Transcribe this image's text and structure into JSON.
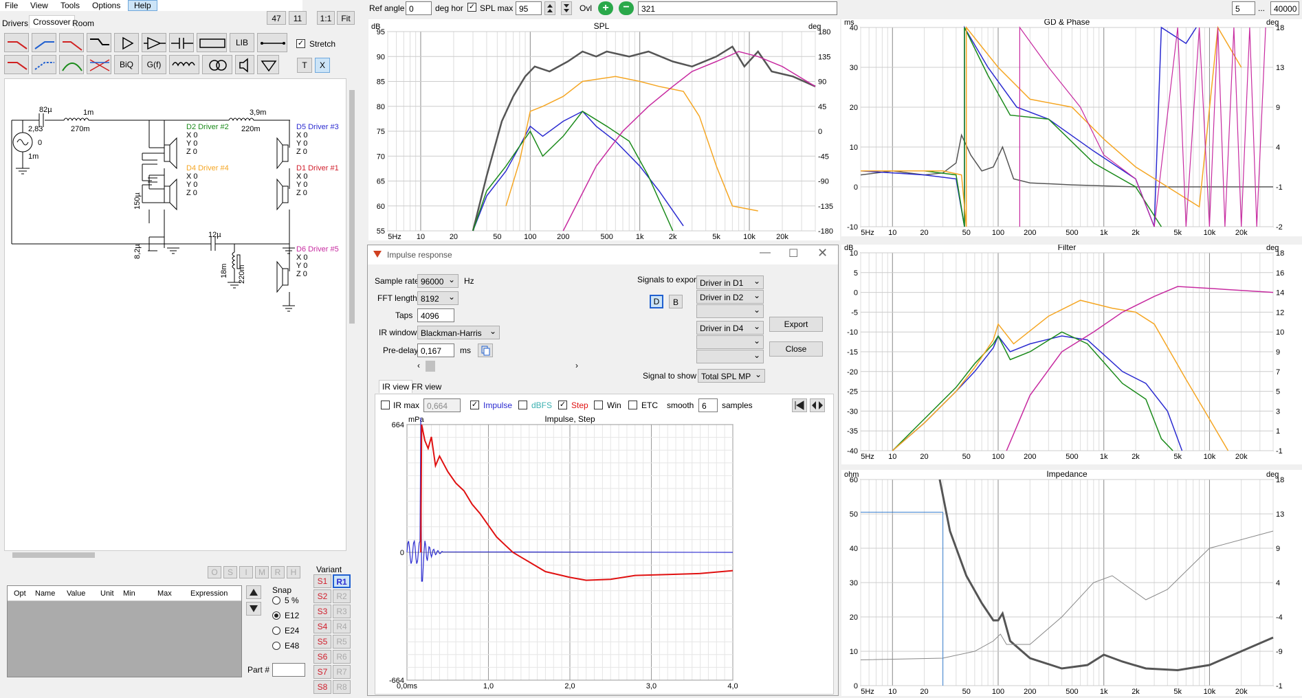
{
  "menu": [
    "File",
    "View",
    "Tools",
    "Options",
    "Help"
  ],
  "tabs": [
    "Drivers",
    "Crossover",
    "Room"
  ],
  "small_buttons": [
    "47",
    "11",
    "1:1",
    "Fit"
  ],
  "tools_row1": [
    "LIB"
  ],
  "tools_row2": [
    "BiQ",
    "G(f)",
    "T",
    "X"
  ],
  "stretch_label": "Stretch",
  "top": {
    "ref_angle_label": "Ref angle",
    "ref_angle": "0",
    "deg_hor": "deg hor",
    "spl_max_label": "SPL max",
    "spl_max": "95",
    "ovl_label": "Ovl",
    "ovl_value": "321",
    "range_lo": "5",
    "range_sep": "...",
    "range_hi": "40000"
  },
  "schematic": {
    "parts": [
      "82µ",
      "1m",
      "270m",
      "2,83",
      "0",
      "1m",
      "150µ",
      "8,2µ",
      "3,9m",
      "220m",
      "12µ",
      "18m",
      "220m"
    ],
    "drivers": [
      {
        "name": "D2 Driver #2",
        "color": "#1a8a1a",
        "xyz": [
          "X 0",
          "Y 0",
          "Z 0"
        ]
      },
      {
        "name": "D4 Driver #4",
        "color": "#f5a623",
        "xyz": [
          "X 0",
          "Y 0",
          "Z 0"
        ]
      },
      {
        "name": "D5 Driver #3",
        "color": "#2a2ad0",
        "xyz": [
          "X 0",
          "Y 0",
          "Z 0"
        ]
      },
      {
        "name": "D1 Driver #1",
        "color": "#d01c2a",
        "xyz": [
          "X 0",
          "Y 0",
          "Z 0"
        ]
      },
      {
        "name": "D6 Driver #5",
        "color": "#c72aa0",
        "xyz": [
          "X 0",
          "Y 0",
          "Z 0"
        ]
      }
    ]
  },
  "opt_buttons": [
    "O",
    "S",
    "I",
    "M",
    "R",
    "H"
  ],
  "table_headers": [
    "Opt",
    "Name",
    "Value",
    "Unit",
    "Min",
    "Max",
    "Expression"
  ],
  "snap": {
    "title": "Snap",
    "options": [
      "5 %",
      "E12",
      "E24",
      "E48"
    ],
    "selected": 1
  },
  "part_label": "Part #",
  "variant": {
    "title": "Variant",
    "s": [
      "S1",
      "S2",
      "S3",
      "S4",
      "S5",
      "S6",
      "S7",
      "S8"
    ],
    "r": [
      "R1",
      "R2",
      "R3",
      "R4",
      "R5",
      "R6",
      "R7",
      "R8"
    ]
  },
  "spl": {
    "title": "SPL",
    "left_unit": "dB",
    "right_unit": "deg",
    "y": [
      "95",
      "90",
      "85",
      "80",
      "75",
      "70",
      "65",
      "60",
      "55"
    ],
    "y2": [
      "180",
      "135",
      "90",
      "45",
      "0",
      "-45",
      "-90",
      "-135",
      "-180"
    ],
    "x": [
      "5Hz",
      "10",
      "20",
      "50",
      "100",
      "200",
      "500",
      "1k",
      "2k",
      "5k",
      "10k",
      "20k"
    ]
  },
  "gd": {
    "title": "GD & Phase",
    "left_unit": "ms",
    "right_unit": "deg",
    "y": [
      "40",
      "30",
      "20",
      "10",
      "0",
      "-10"
    ],
    "y2": [
      "18",
      "13",
      "9",
      "4",
      "-1",
      "-2"
    ],
    "x": [
      "5Hz",
      "10",
      "20",
      "50",
      "100",
      "200",
      "500",
      "1k",
      "2k",
      "5k",
      "10k",
      "20k"
    ]
  },
  "filter": {
    "title": "Filter",
    "left_unit": "dB",
    "right_unit": "deg",
    "y": [
      "10",
      "5",
      "0",
      "-5",
      "-10",
      "-15",
      "-20",
      "-25",
      "-30",
      "-35",
      "-40"
    ],
    "y2": [
      "18",
      "16",
      "14",
      "12",
      "10",
      "9",
      "7",
      "5",
      "3",
      "1",
      "-1"
    ],
    "x": [
      "5Hz",
      "10",
      "20",
      "50",
      "100",
      "200",
      "500",
      "1k",
      "2k",
      "5k",
      "10k",
      "20k"
    ]
  },
  "imp": {
    "title": "Impedance",
    "left_unit": "ohm",
    "right_unit": "deg",
    "y": [
      "60",
      "50",
      "40",
      "30",
      "20",
      "10",
      "0"
    ],
    "y2": [
      "18",
      "13",
      "9",
      "4",
      "-4",
      "-9",
      "-1"
    ],
    "x": [
      "5Hz",
      "10",
      "20",
      "50",
      "100",
      "200",
      "500",
      "1k",
      "2k",
      "5k",
      "10k",
      "20k"
    ]
  },
  "ir": {
    "title": "Impulse response",
    "sample_rate_label": "Sample rate",
    "sample_rate": "96000",
    "hz": "Hz",
    "fft_label": "FFT length",
    "fft": "8192",
    "taps_label": "Taps",
    "taps": "4096",
    "window_label": "IR window",
    "window": "Blackman-Harris",
    "predelay_label": "Pre-delay",
    "predelay": "0,167",
    "ms": "ms",
    "signals_label": "Signals to export",
    "signals": [
      "Driver in D1",
      "Driver in D2",
      "",
      "Driver in D4",
      "",
      ""
    ],
    "db": [
      "D",
      "B"
    ],
    "export": "Export",
    "close": "Close",
    "show_label": "Signal to show",
    "show": "Total SPL MP",
    "subtabs": [
      "IR view",
      "FR view"
    ],
    "ir_max_label": "IR max",
    "ir_max": "0,664",
    "impulse": "Impulse",
    "dbfs": "dBFS",
    "step": "Step",
    "win": "Win",
    "etc": "ETC",
    "smooth": "smooth",
    "smooth_val": "6",
    "samples": "samples",
    "plot_title": "Impulse, Step",
    "unit": "mPa",
    "y": [
      "664",
      "0",
      "-664"
    ],
    "x": [
      "0,0ms",
      "1,0",
      "2,0",
      "3,0",
      "4,0"
    ]
  }
}
